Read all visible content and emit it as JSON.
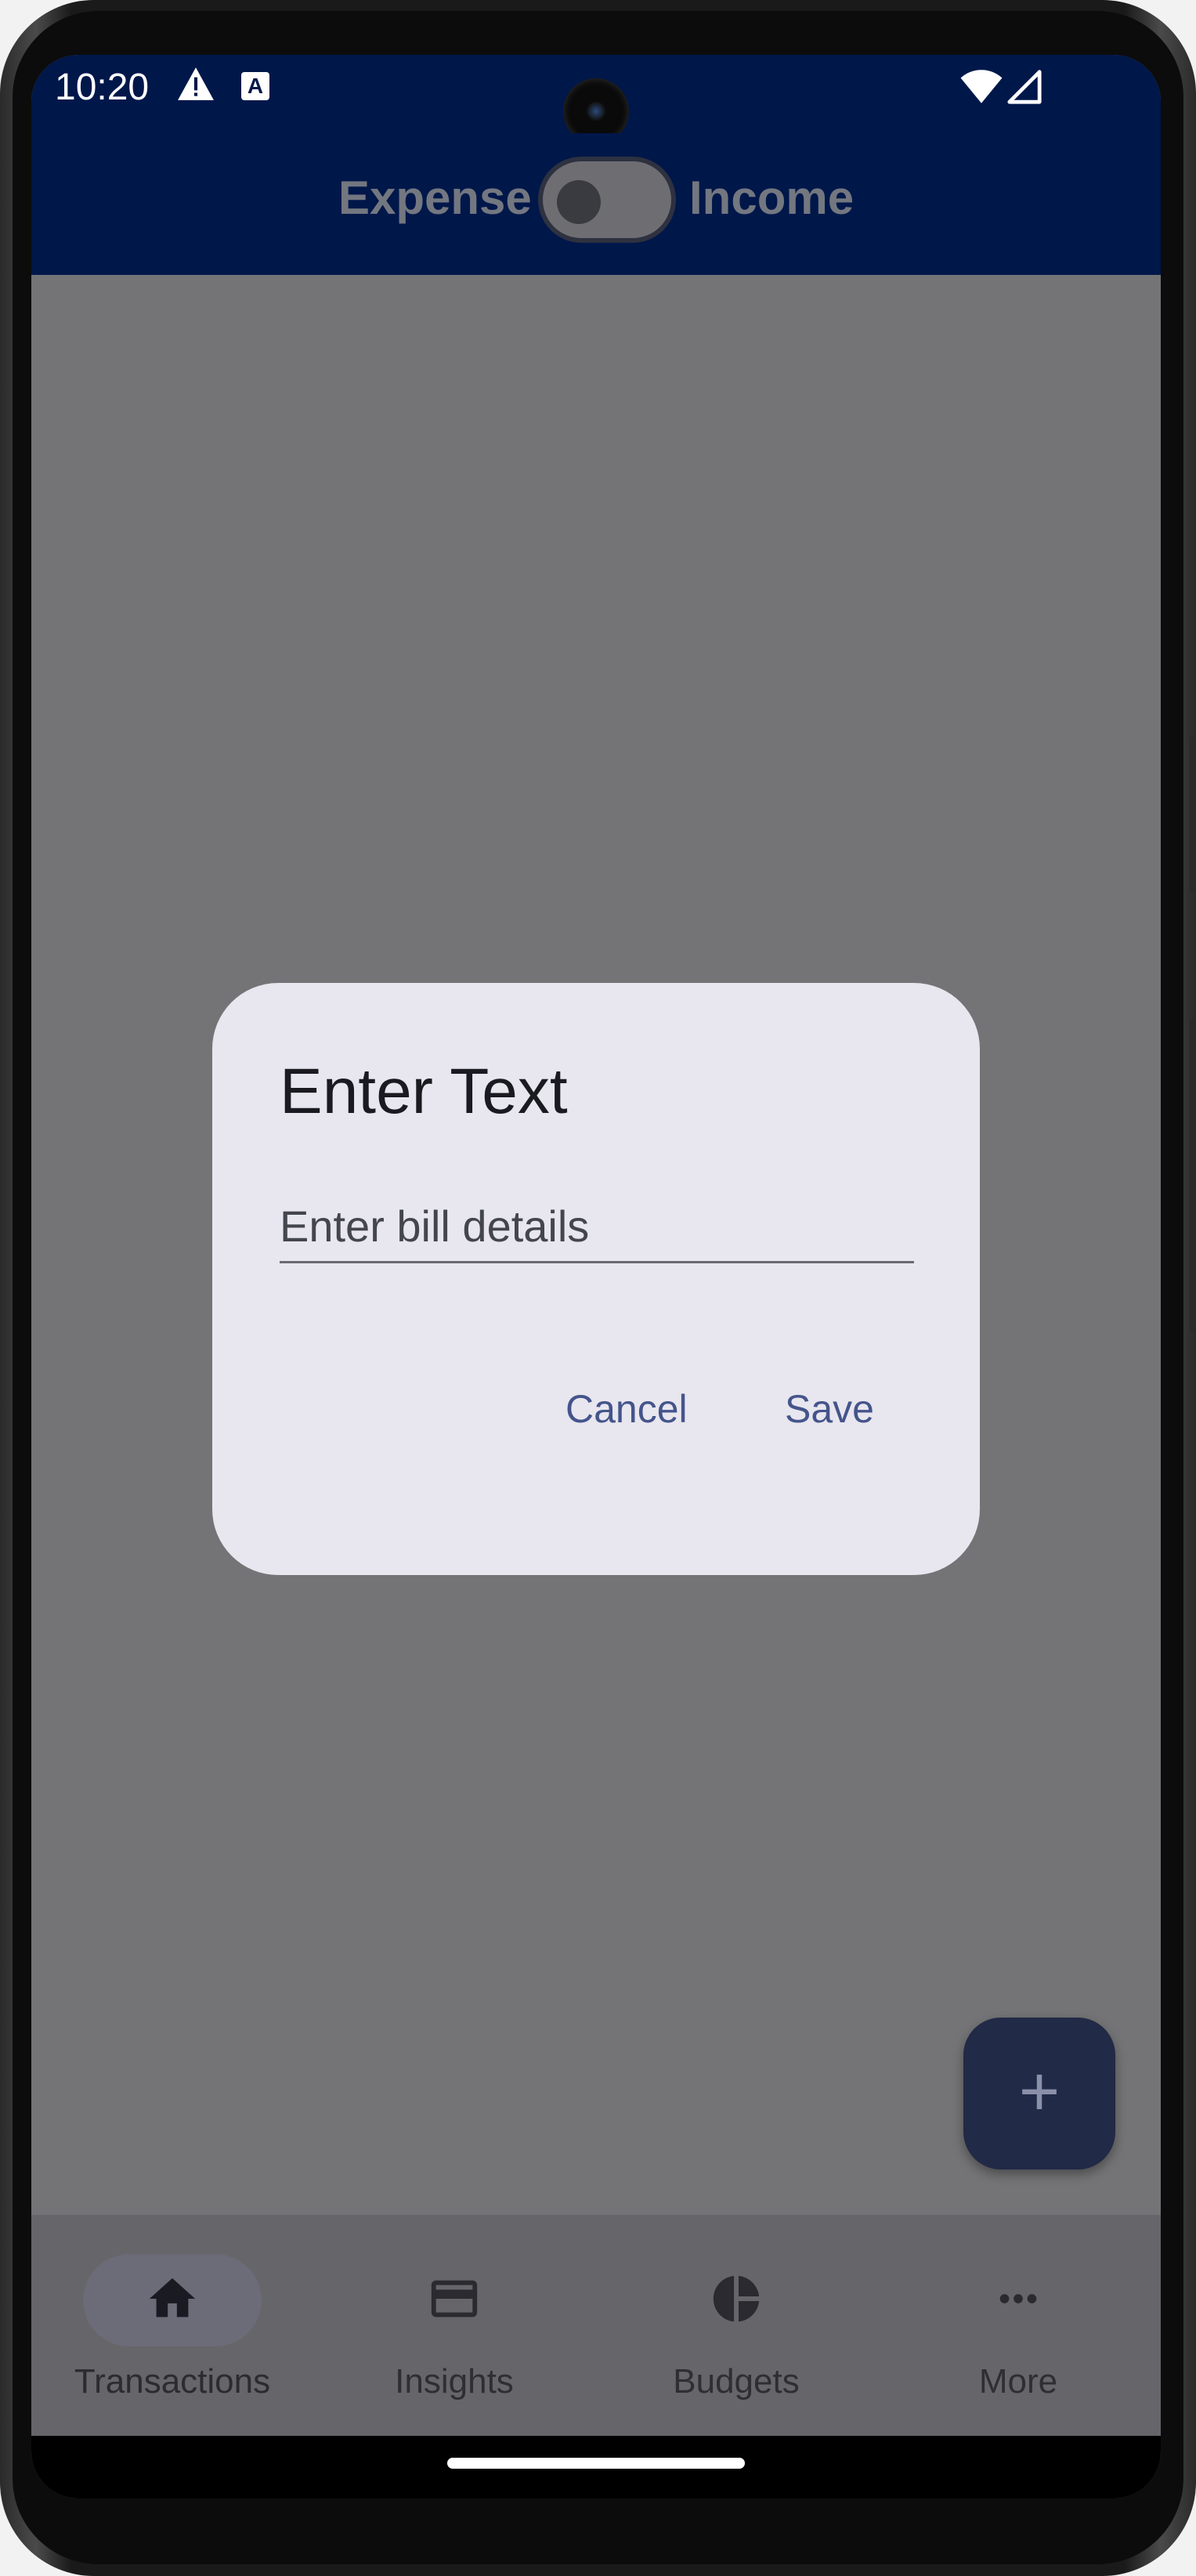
{
  "status_bar": {
    "time": "10:20",
    "icons": [
      "warning-icon",
      "a-notification-icon",
      "wifi-icon",
      "signal-icon"
    ],
    "a_glyph": "A"
  },
  "app_bar": {
    "toggle_left_label": "Expense",
    "toggle_right_label": "Income",
    "toggle_state": "off",
    "background": "#00174a"
  },
  "dialog": {
    "title": "Enter Text",
    "input_placeholder": "Enter bill details",
    "input_value": "",
    "cancel_label": "Cancel",
    "save_label": "Save"
  },
  "fab": {
    "icon": "plus-icon",
    "glyph": "+"
  },
  "bottom_nav": {
    "items": [
      {
        "label": "Transactions",
        "icon": "home-icon",
        "selected": true
      },
      {
        "label": "Insights",
        "icon": "credit-card-icon",
        "selected": false
      },
      {
        "label": "Budgets",
        "icon": "pie-chart-icon",
        "selected": false
      },
      {
        "label": "More",
        "icon": "more-horiz-icon",
        "selected": false
      }
    ]
  }
}
